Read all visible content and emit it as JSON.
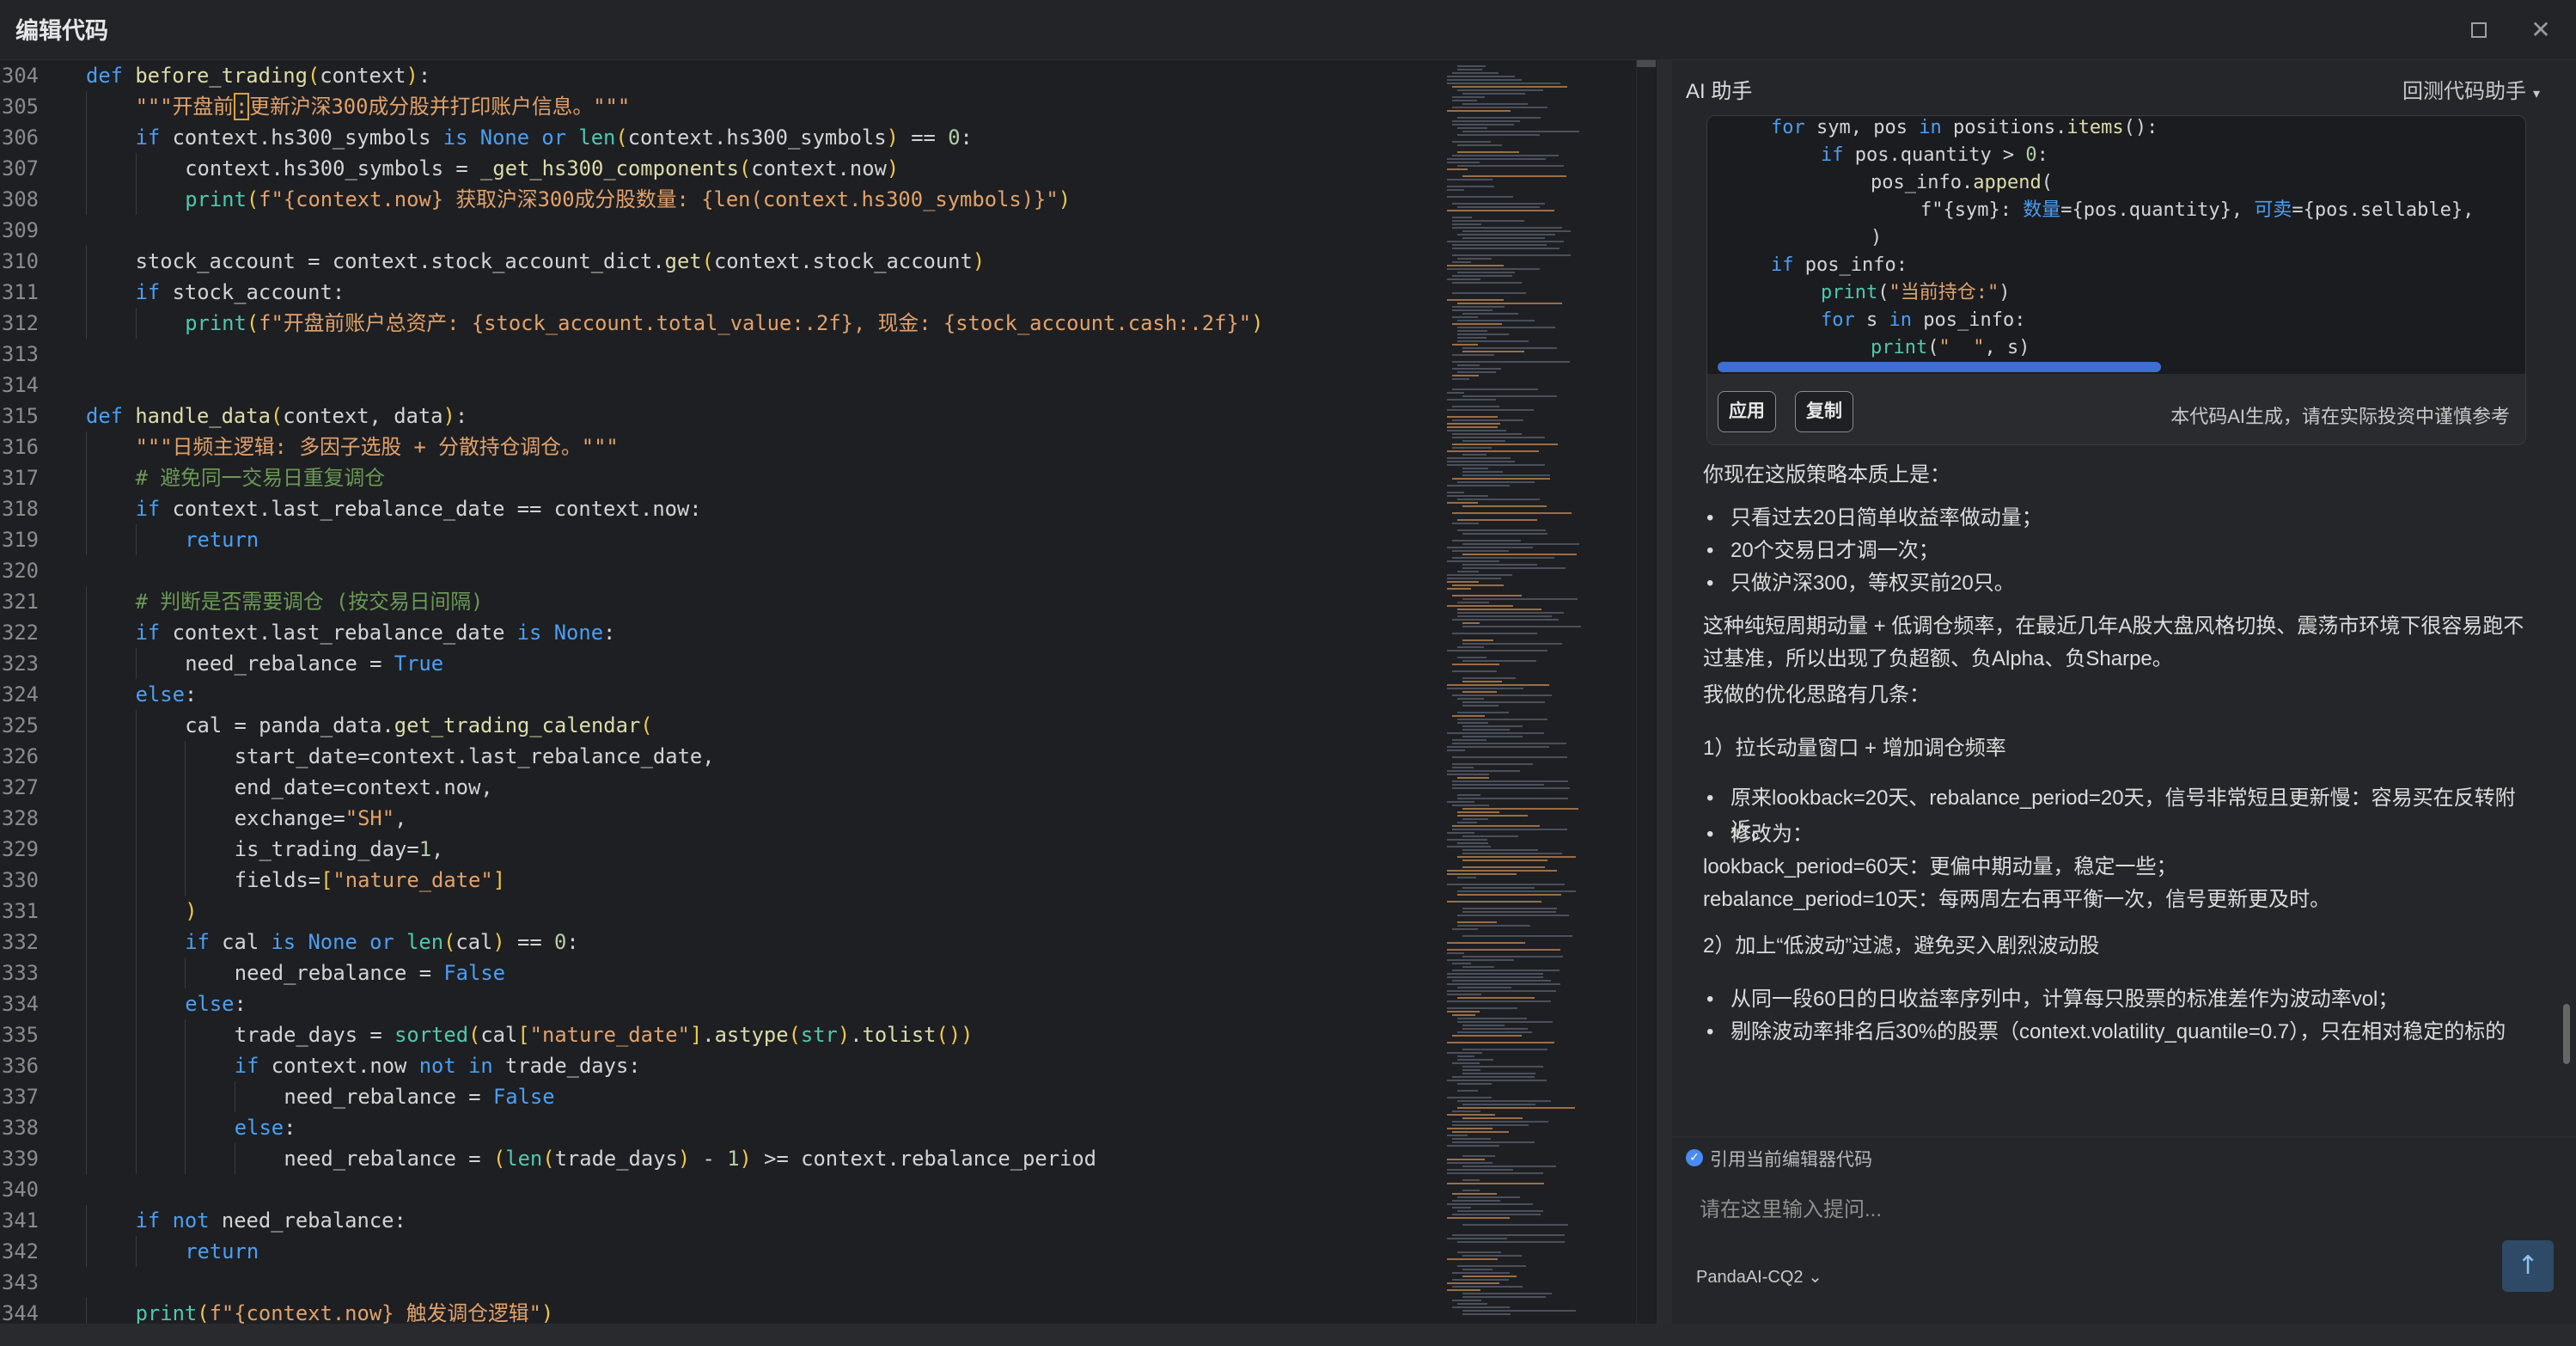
{
  "window": {
    "title": "编辑代码",
    "maximize_icon": "maximize-icon",
    "close_icon": "close-icon",
    "close_glyph": "✕"
  },
  "editor": {
    "lines": [
      {
        "n": "304",
        "indent": 0,
        "html": "<span class='kw'>def</span> <span class='fn'>before_trading</span><span class='pr'>(</span>context<span class='pr'>)</span>:"
      },
      {
        "n": "305",
        "indent": 1,
        "html": "<span class='st'>\"\"\"开盘前<span class='cursor-box'>:</span>更新沪深300成分股并打印账户信息。\"\"\"</span>"
      },
      {
        "n": "306",
        "indent": 1,
        "html": "<span class='kw'>if</span> context.hs300_symbols <span class='kw'>is</span> <span class='cst'>None</span> <span class='kw'>or</span> <span class='bi'>len</span><span class='pr'>(</span>context.hs300_symbols<span class='pr'>)</span> == <span class='nm'>0</span>:"
      },
      {
        "n": "307",
        "indent": 2,
        "html": "context.hs300_symbols = <span class='fn'>_get_hs300_components</span><span class='pr'>(</span>context.now<span class='pr'>)</span>"
      },
      {
        "n": "308",
        "indent": 2,
        "html": "<span class='bi'>print</span><span class='pr'>(</span><span class='st'>f\"{context.now} 获取沪深300成分股数量: {len(context.hs300_symbols)}\"</span><span class='pr'>)</span>"
      },
      {
        "n": "309",
        "indent": 0,
        "html": ""
      },
      {
        "n": "310",
        "indent": 1,
        "html": "stock_account = context.stock_account_dict.<span class='fn'>get</span><span class='pr'>(</span>context.stock_account<span class='pr'>)</span>"
      },
      {
        "n": "311",
        "indent": 1,
        "html": "<span class='kw'>if</span> stock_account:"
      },
      {
        "n": "312",
        "indent": 2,
        "html": "<span class='bi'>print</span><span class='pr'>(</span><span class='st'>f\"开盘前账户总资产: {stock_account.total_value:.2f}, 现金: {stock_account.cash:.2f}\"</span><span class='pr'>)</span>"
      },
      {
        "n": "313",
        "indent": 0,
        "html": ""
      },
      {
        "n": "314",
        "indent": 0,
        "html": ""
      },
      {
        "n": "315",
        "indent": 0,
        "html": "<span class='kw'>def</span> <span class='fn'>handle_data</span><span class='pr'>(</span>context, data<span class='pr'>)</span>:"
      },
      {
        "n": "316",
        "indent": 1,
        "html": "<span class='st'>\"\"\"日频主逻辑: 多因子选股 + 分散持仓调仓。\"\"\"</span>"
      },
      {
        "n": "317",
        "indent": 1,
        "html": "<span class='cm'># 避免同一交易日重复调仓</span>"
      },
      {
        "n": "318",
        "indent": 1,
        "html": "<span class='kw'>if</span> context.last_rebalance_date == context.now:"
      },
      {
        "n": "319",
        "indent": 2,
        "html": "<span class='kw'>return</span>"
      },
      {
        "n": "320",
        "indent": 0,
        "html": ""
      },
      {
        "n": "321",
        "indent": 1,
        "html": "<span class='cm'># 判断是否需要调仓 (按交易日间隔)</span>"
      },
      {
        "n": "322",
        "indent": 1,
        "html": "<span class='kw'>if</span> context.last_rebalance_date <span class='kw'>is</span> <span class='cst'>None</span>:"
      },
      {
        "n": "323",
        "indent": 2,
        "html": "need_rebalance = <span class='cst'>True</span>"
      },
      {
        "n": "324",
        "indent": 1,
        "html": "<span class='kw'>else</span>:"
      },
      {
        "n": "325",
        "indent": 2,
        "html": "cal = panda_data.<span class='fn'>get_trading_calendar</span><span class='pr'>(</span>"
      },
      {
        "n": "326",
        "indent": 3,
        "html": "start_date=context.last_rebalance_date,"
      },
      {
        "n": "327",
        "indent": 3,
        "html": "end_date=context.now,"
      },
      {
        "n": "328",
        "indent": 3,
        "html": "exchange=<span class='st'>\"SH\"</span>,"
      },
      {
        "n": "329",
        "indent": 3,
        "html": "is_trading_day=<span class='nm'>1</span>,"
      },
      {
        "n": "330",
        "indent": 3,
        "html": "fields=<span class='pr'>[</span><span class='st'>\"nature_date\"</span><span class='pr'>]</span>"
      },
      {
        "n": "331",
        "indent": 2,
        "html": "<span class='pr'>)</span>"
      },
      {
        "n": "332",
        "indent": 2,
        "html": "<span class='kw'>if</span> cal <span class='kw'>is</span> <span class='cst'>None</span> <span class='kw'>or</span> <span class='bi'>len</span><span class='pr'>(</span>cal<span class='pr'>)</span> == <span class='nm'>0</span>:"
      },
      {
        "n": "333",
        "indent": 3,
        "html": "need_rebalance = <span class='cst'>False</span>"
      },
      {
        "n": "334",
        "indent": 2,
        "html": "<span class='kw'>else</span>:"
      },
      {
        "n": "335",
        "indent": 3,
        "html": "trade_days = <span class='bi'>sorted</span><span class='pr'>(</span>cal<span class='pr'>[</span><span class='st'>\"nature_date\"</span><span class='pr'>]</span>.<span class='fn'>astype</span><span class='pr'>(</span><span class='bi'>str</span><span class='pr'>)</span>.<span class='fn'>tolist</span><span class='pr'>())</span>"
      },
      {
        "n": "336",
        "indent": 3,
        "html": "<span class='kw'>if</span> context.now <span class='kw'>not</span> <span class='kw'>in</span> trade_days:"
      },
      {
        "n": "337",
        "indent": 4,
        "html": "need_rebalance = <span class='cst'>False</span>"
      },
      {
        "n": "338",
        "indent": 3,
        "html": "<span class='kw'>else</span>:"
      },
      {
        "n": "339",
        "indent": 4,
        "html": "need_rebalance = <span class='pr'>(</span><span class='bi'>len</span><span class='pr'>(</span>trade_days<span class='pr'>)</span> - <span class='nm'>1</span><span class='pr'>)</span> >= context.rebalance_period"
      },
      {
        "n": "340",
        "indent": 0,
        "html": ""
      },
      {
        "n": "341",
        "indent": 1,
        "html": "<span class='kw'>if</span> <span class='kw'>not</span> need_rebalance:"
      },
      {
        "n": "342",
        "indent": 2,
        "html": "<span class='kw'>return</span>"
      },
      {
        "n": "343",
        "indent": 0,
        "html": ""
      },
      {
        "n": "344",
        "indent": 1,
        "html": "<span class='bi'>print</span><span class='pr'>(</span><span class='st'>f\"{context.now} 触发调仓逻辑\"</span><span class='pr'>)</span>"
      }
    ]
  },
  "ai_panel": {
    "title": "AI 助手",
    "mode": "回测代码助手",
    "mode_icon": "chevron-down-icon",
    "code_card": {
      "lines": [
        {
          "indent": 1,
          "html": "<span class='kw'>for</span> sym, pos <span class='kw'>in</span> positions.<span class='fn'>items</span>():"
        },
        {
          "indent": 2,
          "html": "<span class='kw'>if</span> pos.quantity > <span class='nm'>0</span>:"
        },
        {
          "indent": 3,
          "html": "pos_info.<span class='fn'>append</span>("
        },
        {
          "indent": 4,
          "html": "f\"{sym}: <span class='zh kw'>数量</span>={pos.quantity}, <span class='zh kw'>可卖</span>={pos.sellable},"
        },
        {
          "indent": 3,
          "html": ")"
        },
        {
          "indent": 1,
          "html": "<span class='kw'>if</span> pos_info:"
        },
        {
          "indent": 2,
          "html": "<span class='bi'>print</span>(<span class='st'>\"<span class='zh'>当前持仓</span>:\"</span>)"
        },
        {
          "indent": 2,
          "html": "<span class='kw'>for</span> s <span class='kw'>in</span> pos_info:"
        },
        {
          "indent": 3,
          "html": "<span class='bi'>print</span>(<span class='st'>\"  \"</span>, s)"
        }
      ],
      "apply_label": "应用",
      "copy_label": "复制",
      "disclaimer": "本代码AI生成，请在实际投资中谨慎参考"
    },
    "content": [
      {
        "type": "p",
        "text": "你现在这版策略本质上是："
      },
      {
        "type": "li",
        "text": "只看过去20日简单收益率做动量；"
      },
      {
        "type": "li",
        "text": "20个交易日才调一次；"
      },
      {
        "type": "li",
        "text": "只做沪深300，等权买前20只。"
      },
      {
        "type": "p",
        "text": "这种纯短周期动量 + 低调仓频率，在最近几年A股大盘风格切换、震荡市环境下很容易跑不过基准，所以出现了负超额、负Alpha、负Sharpe。"
      },
      {
        "type": "p",
        "text": "我做的优化思路有几条："
      },
      {
        "type": "p",
        "text": "1）拉长动量窗口 + 增加调仓频率"
      },
      {
        "type": "li",
        "text": "原来lookback=20天、rebalance_period=20天，信号非常短且更新慢：容易买在反转附近。"
      },
      {
        "type": "li",
        "text": "修改为："
      },
      {
        "type": "p",
        "text": "lookback_period=60天：更偏中期动量，稳定一些；"
      },
      {
        "type": "p",
        "text": "rebalance_period=10天：每两周左右再平衡一次，信号更新更及时。"
      },
      {
        "type": "p",
        "text": "2）加上“低波动”过滤，避免买入剧烈波动股"
      },
      {
        "type": "li",
        "text": "从同一段60日的日收益率序列中，计算每只股票的标准差作为波动率vol；"
      },
      {
        "type": "li",
        "text": "剔除波动率排名后30%的股票（context.volatility_quantile=0.7），只在相对稳定的标的"
      }
    ],
    "reference_label": "引用当前编辑器代码",
    "input_placeholder": "请在这里输入提问...",
    "model": "PandaAI-CQ2",
    "send_icon": "arrow-up-icon"
  }
}
